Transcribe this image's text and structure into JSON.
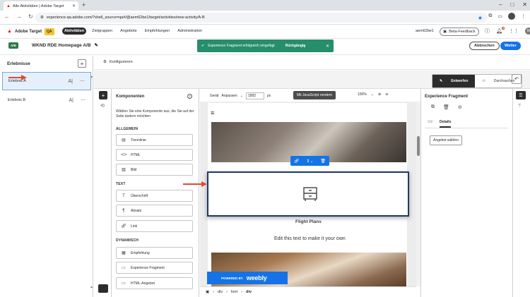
{
  "browser": {
    "tab_title": "Alle Aktivitäten | Adobe Target",
    "new_tab": "+",
    "url": "experience-qa.adobe.com/?shell_source=qa#/@aem62be1/target/activities/new-activity/A-B"
  },
  "header": {
    "product": "Adobe Target",
    "env_badge": "QA",
    "nav": [
      "Aktivitäten",
      "Zielgruppen",
      "Angebote",
      "Empfehlungen",
      "Administration"
    ],
    "org": "aem62be1",
    "beta_feedback": "Beta-Feedback",
    "notifications_count": "3",
    "avatar_initial": "M"
  },
  "activity": {
    "type_badge": "A/B",
    "title": "WKND RDE Homepage A/B",
    "toast_message": "Experience Fragment erfolgreich eingefügt",
    "toast_undo": "Rückgängig",
    "cancel_label": "Abbrechen",
    "next_label": "Weiter"
  },
  "experiences": {
    "header": "Erlebnisse",
    "items": [
      {
        "label": "Erlebnis A"
      },
      {
        "label": "Erlebnis B"
      }
    ]
  },
  "config": {
    "label": "Konfigurieren"
  },
  "toolbar": {
    "edit_label": "Entwerfen",
    "browse_label": "Durchsuchen"
  },
  "components": {
    "title": "Komponenten",
    "description": "Wählen Sie eine Komponente aus, die Sie auf der Seite ändern möchten",
    "sections": [
      {
        "name": "ALLGEMEIN",
        "items": [
          "Trennlinie",
          "HTML",
          "Bild"
        ]
      },
      {
        "name": "TEXT",
        "items": [
          "Überschrift",
          "Absatz",
          "Link"
        ]
      },
      {
        "name": "DYNAMISCH",
        "items": [
          "Empfehlung",
          "Experience Fragment",
          "HTML-Angebot"
        ]
      }
    ]
  },
  "canvas": {
    "device_label": "Gerät",
    "device_value": "Anpassen",
    "width_value": "1892",
    "width_unit": "px",
    "js_button": "Mit JavaScript rendern",
    "zoom": "100%",
    "heading": "Flight Plans",
    "body_text": "Edit this text to make it your own",
    "powered_by": "POWERED BY",
    "weebly": "weebly",
    "breadcrumbs": [
      "div",
      "font",
      "div"
    ]
  },
  "right_panel": {
    "title": "Experience Fragment",
    "tabs": [
      "Stil",
      "Details"
    ],
    "angebot_button": "Angebot wählen"
  },
  "colors": {
    "accent": "#1473e6",
    "toast": "#268e6c",
    "arrow": "#e04a2f"
  }
}
